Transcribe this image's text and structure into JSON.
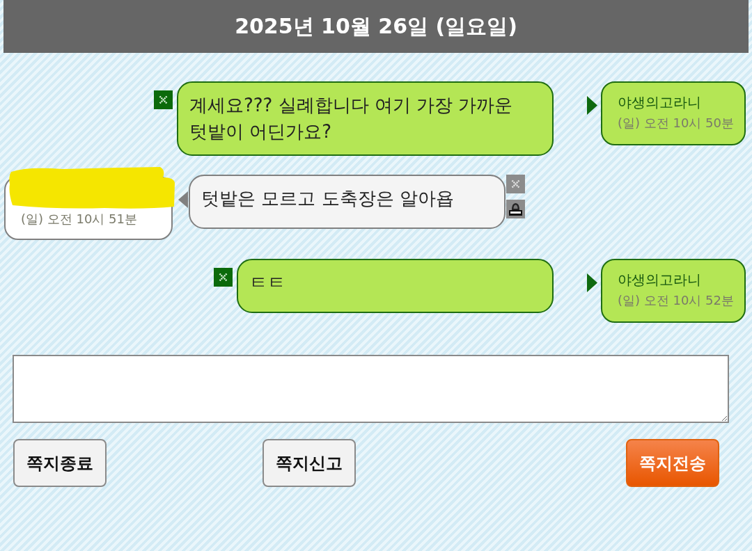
{
  "header": {
    "date": "2025년 10월 26일 (일요일)"
  },
  "messages": [
    {
      "kind": "sent",
      "text": "계세요??? 실례합니다 여기 가장 가까운 텃밭이 어딘가요?",
      "sender": "야생의고라니",
      "sender_redacted": false,
      "time": "(일) 오전 10시 50분"
    },
    {
      "kind": "received",
      "text": "텃밭은 모르고 도축장은 알아욥",
      "sender_redacted": true,
      "time": "(일) 오전 10시 51분"
    },
    {
      "kind": "sent",
      "text": "ㅌㅌ",
      "sender": "야생의고라니",
      "sender_redacted": false,
      "time": "(일) 오전 10시 52분"
    }
  ],
  "buttons": [
    {
      "label": "쪽지종료",
      "kind": "plain"
    },
    {
      "label": "쪽지신고",
      "kind": "plain"
    },
    {
      "label": "쪽지전송",
      "kind": "primary"
    }
  ]
}
